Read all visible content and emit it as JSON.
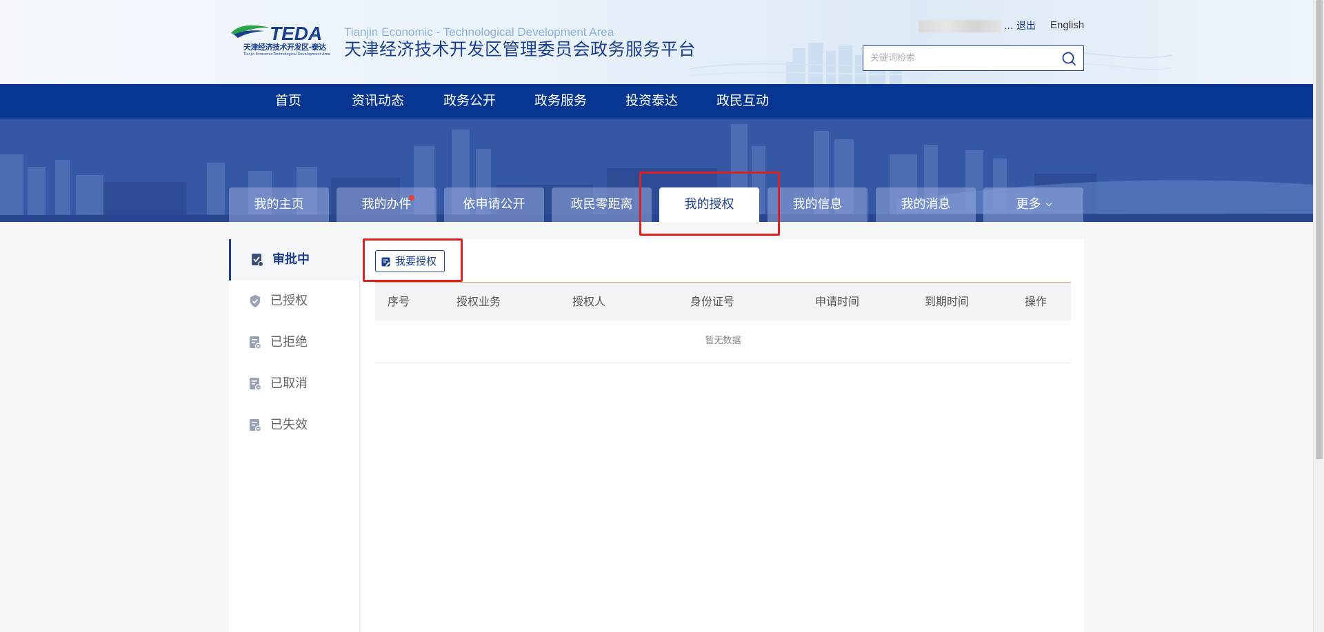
{
  "header": {
    "logo": {
      "brand": "TEDA",
      "cn": "天津经济技术开发区-泰达",
      "en": "Tianjin Economic-Technological Development Area"
    },
    "site_en": "Tianjin Economic - Technological Development Area",
    "site_cn": "天津经济技术开发区管理委员会政务服务平台",
    "user_ellipsis": "...",
    "logout_label": "退出",
    "english_label": "English",
    "search": {
      "placeholder": "关键词检索",
      "icon": "search-icon"
    }
  },
  "topnav": [
    {
      "label": "首页"
    },
    {
      "label": "资讯动态"
    },
    {
      "label": "政务公开"
    },
    {
      "label": "政务服务"
    },
    {
      "label": "投资泰达"
    },
    {
      "label": "政民互动"
    }
  ],
  "tabs": [
    {
      "label": "我的主页"
    },
    {
      "label": "我的办件",
      "has_notification": true
    },
    {
      "label": "依申请公开"
    },
    {
      "label": "政民零距离"
    },
    {
      "label": "我的授权",
      "active": true
    },
    {
      "label": "我的信息"
    },
    {
      "label": "我的消息"
    },
    {
      "label": "更多",
      "icon": "chevron-down-icon"
    }
  ],
  "sidebar": [
    {
      "label": "审批中",
      "icon": "clipboard-check-icon",
      "active": true
    },
    {
      "label": "已授权",
      "icon": "shield-check-icon"
    },
    {
      "label": "已拒绝",
      "icon": "doc-reject-icon"
    },
    {
      "label": "已取消",
      "icon": "doc-cancel-icon"
    },
    {
      "label": "已失效",
      "icon": "doc-expired-icon"
    }
  ],
  "main": {
    "auth_button": {
      "label": "我要授权",
      "icon": "edit-doc-icon"
    },
    "columns": [
      "序号",
      "授权业务",
      "授权人",
      "身份证号",
      "申请时间",
      "到期时间",
      "操作"
    ],
    "rows": [],
    "empty_text": "暂无数据"
  },
  "colors": {
    "primary": "#063592",
    "brand_text": "#1b3f8f",
    "highlight": "#e02020",
    "notification_dot": "#e6433c",
    "divider_accent": "#c9a56a"
  }
}
